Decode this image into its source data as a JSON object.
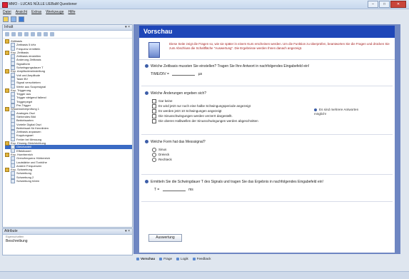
{
  "window": {
    "title": "MMO - LUCAS NÜLLE LIEBaM Questioner",
    "min": "–",
    "max": "□",
    "close": "✕"
  },
  "menu": [
    "Datei",
    "Ansicht",
    "Extras",
    "Werkzeuge",
    "Hilfe"
  ],
  "left_pane": {
    "title": "Inhalt",
    "pin": "▾ ×",
    "tree": [
      {
        "label": "Zeitbasis",
        "type": "folder"
      },
      {
        "label": "Zeitbasis 5 kHz",
        "type": "leaf"
      },
      {
        "label": "Frequenz ermitteln",
        "type": "leaf"
      },
      {
        "label": "Exp. Zeitbasis",
        "type": "folder"
      },
      {
        "label": "Zeitbasis einstellen",
        "type": "leaf"
      },
      {
        "label": "Änderung Zeitbasis",
        "type": "leaf"
      },
      {
        "label": "Signalform",
        "type": "leaf"
      },
      {
        "label": "Schwingungsdauer T",
        "type": "leaf"
      },
      {
        "label": "Exp. Amplitudeneinstellung",
        "type": "folder"
      },
      {
        "label": "Volt und Amplitude",
        "type": "leaf"
      },
      {
        "label": "Taste BV",
        "type": "leaf"
      },
      {
        "label": "Signal verschieben",
        "type": "leaf"
      },
      {
        "label": "Werte aus Scopesignal",
        "type": "leaf"
      },
      {
        "label": "Exp. Triggerung",
        "type": "folder"
      },
      {
        "label": "Trigger aus",
        "type": "leaf"
      },
      {
        "label": "Trigger steigend fallend",
        "type": "leaf"
      },
      {
        "label": "Triggerpegel",
        "type": "leaf"
      },
      {
        "label": "Pre-Trigger",
        "type": "leaf"
      },
      {
        "label": "Wissensüberprüfung 1",
        "type": "folder"
      },
      {
        "label": "Analoges Oszi",
        "type": "leaf"
      },
      {
        "label": "Stehendes Bild",
        "type": "leaf"
      },
      {
        "label": "Betriebsarten",
        "type": "leaf"
      },
      {
        "label": "Vorteile Digital Oszi",
        "type": "leaf"
      },
      {
        "label": "Betriebsart für Kennlinien",
        "type": "leaf"
      },
      {
        "label": "Zeitbasis anpassen",
        "type": "leaf"
      },
      {
        "label": "Kopplungsart",
        "type": "leaf"
      },
      {
        "label": "Fehler bei Messung",
        "type": "leaf"
      },
      {
        "label": "Exp. Einweg-Gleichrichtung",
        "type": "folder"
      },
      {
        "label": "Gleichanteil",
        "type": "leaf",
        "selected": true
      },
      {
        "label": "Effektivwert",
        "type": "leaf"
      },
      {
        "label": "Exp. Hoerbereich",
        "type": "folder"
      },
      {
        "label": "Grenzfrequenz Hörbereich",
        "type": "leaf"
      },
      {
        "label": "Lautstärke und Tonhöhe",
        "type": "leaf"
      },
      {
        "label": "Andere Frequenzen",
        "type": "leaf"
      },
      {
        "label": "Exp. Schwebung",
        "type": "folder"
      },
      {
        "label": "Schwebung",
        "type": "leaf"
      },
      {
        "label": "Schwebung 2",
        "type": "leaf"
      },
      {
        "label": "Schwebung hören",
        "type": "leaf"
      }
    ]
  },
  "properties": {
    "title": "Attribute",
    "pin": "▾ ×",
    "section": "Eigenschaften",
    "value": "Beschreibung"
  },
  "preview": {
    "title": "Vorschau",
    "intro": "Diese Seite zeigt die Fragen so, wie sie später in einem Kurs erscheinen werden. Um die Funktion zu überprüfen, beantworten Sie die Fragen und drücken Sie zum Abschluss die Schaltfläche \"Auswertung\". Die Ergebnisse werden Ihnen danach angezeigt.",
    "q1": {
      "text": "Welche Zeitbasis mussten Sie einstellen? Tragen Sie Ihre Antwort in nachfolgendes Eingabefeld ein!",
      "prefix": "TIME/DIV =",
      "unit": "µs"
    },
    "q2": {
      "text": "Welche Änderungen ergeben sich?",
      "options": [
        "Gar keine",
        "Es wird jetzt nur noch eine halbe Schwingungsperiode angezeigt",
        "Es werden jetzt 10 Schwingungen angezeigt",
        "Die Sinusschwingungen werden verzerrt dargestellt.",
        "Die oberen Halbwellen der Sinusschwingungen werden abgeschnitten"
      ],
      "hint": "Es sind mehrere Antworten möglich!"
    },
    "q3": {
      "text": "Welche Form hat das Messsignal?",
      "options": [
        "Sinus",
        "Dreieck",
        "Rechteck"
      ]
    },
    "q4": {
      "text": "Ermitteln Sie die Schwingdauer T des Signals und tragen Sie das Ergebnis in nachfolgendes Eingabefeld ein!",
      "prefix": "T =",
      "unit": "ms"
    },
    "button": "Auswertung"
  },
  "tabs": [
    "Vorschau",
    "Frage",
    "Logik",
    "Feedback"
  ]
}
